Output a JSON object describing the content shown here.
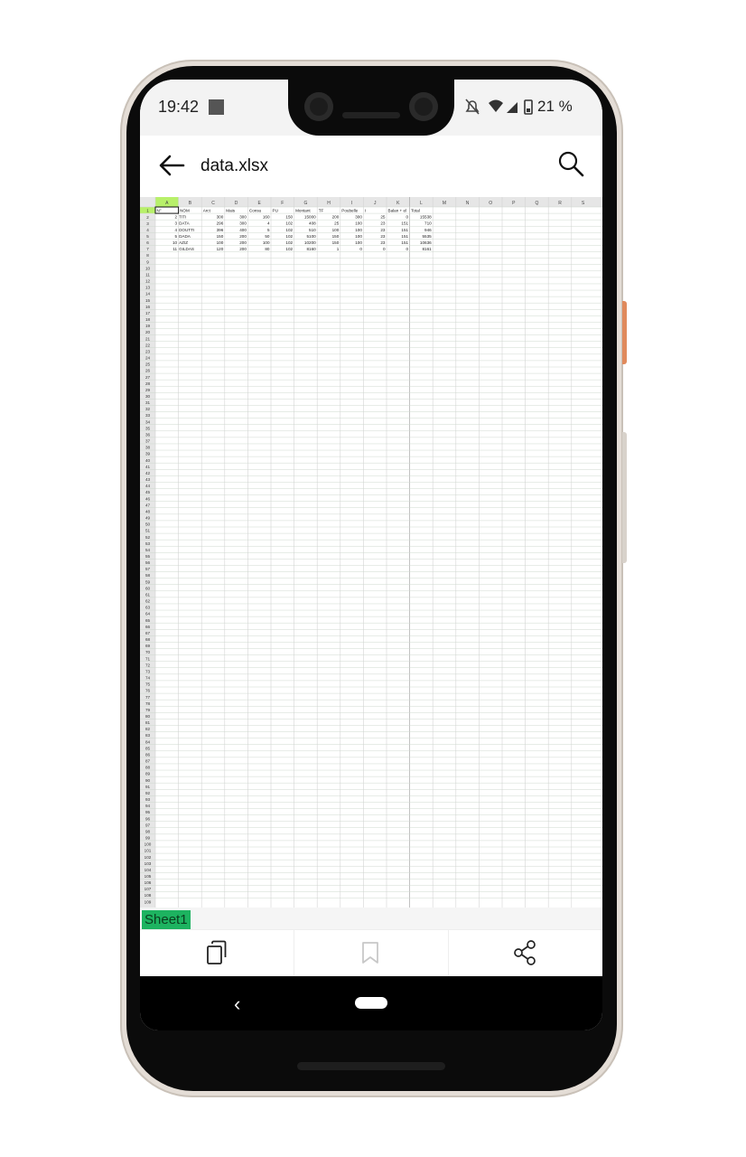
{
  "status_bar": {
    "time": "19:42",
    "battery": "21 %"
  },
  "app_bar": {
    "title": "data.xlsx"
  },
  "sheet": {
    "columns": [
      "A",
      "B",
      "C",
      "D",
      "E",
      "F",
      "G",
      "H",
      "I",
      "J",
      "K",
      "L",
      "M",
      "N",
      "O",
      "P",
      "Q",
      "R",
      "S"
    ],
    "header_row": [
      "N°",
      "NOM",
      "Arct",
      "Mais",
      "Consu",
      "PU",
      "Montant",
      "TF",
      "Poubelle",
      "I",
      "Balan + el",
      "Total"
    ],
    "rows": [
      [
        "2",
        "TITI",
        "300",
        "300",
        "160",
        "150",
        "15000",
        "200",
        "300",
        "25",
        "0",
        "15538"
      ],
      [
        "3",
        "DATA",
        "296",
        "300",
        "4",
        "102",
        "408",
        "25",
        "100",
        "23",
        "151",
        "710"
      ],
      [
        "4",
        "DOUTTI",
        "396",
        "400",
        "5",
        "102",
        "510",
        "100",
        "100",
        "23",
        "151",
        "946"
      ],
      [
        "5",
        "DADA",
        "150",
        "200",
        "50",
        "102",
        "5100",
        "150",
        "100",
        "23",
        "151",
        "5535"
      ],
      [
        "10",
        "AZIZ",
        "100",
        "200",
        "100",
        "102",
        "10200",
        "150",
        "100",
        "23",
        "151",
        "10636"
      ],
      [
        "11",
        "GILDAS",
        "120",
        "200",
        "80",
        "102",
        "8160",
        "1",
        "0",
        "0",
        "0",
        "8161"
      ]
    ],
    "row_count": 109,
    "active_cell": "A1"
  },
  "sheet_tabs": [
    "Sheet1"
  ],
  "bottom_actions": [
    "copy-icon",
    "bookmark-icon",
    "share-icon"
  ],
  "colors": {
    "tab_green": "#1db360",
    "active_header": "#b8f06a"
  }
}
